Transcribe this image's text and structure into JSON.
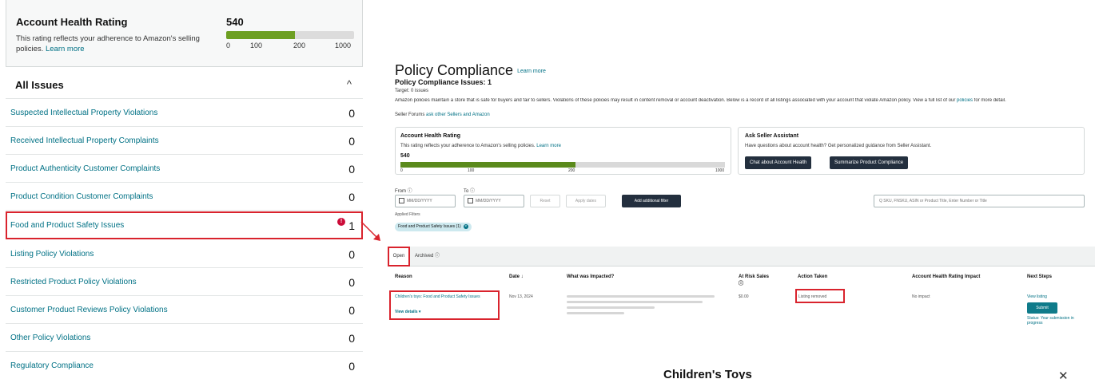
{
  "left_panel": {
    "ahr": {
      "title": "Account Health Rating",
      "description": "This rating reflects your adherence to Amazon's selling policies.",
      "learn_more": "Learn more",
      "score": "540",
      "score_fraction": 0.54,
      "bar_color": "#6d9f22",
      "ticks": [
        "0",
        "100",
        "200",
        "1000"
      ]
    },
    "all_issues": {
      "title": "All Issues",
      "chevron": "^"
    },
    "issues": [
      {
        "label": "Suspected Intellectual Property Violations",
        "count": "0"
      },
      {
        "label": "Received Intellectual Property Complaints",
        "count": "0"
      },
      {
        "label": "Product Authenticity Customer Complaints",
        "count": "0"
      },
      {
        "label": "Product Condition Customer Complaints",
        "count": "0"
      },
      {
        "label": "Food and Product Safety Issues",
        "count": "1",
        "alert": "!"
      },
      {
        "label": "Listing Policy Violations",
        "count": "0"
      },
      {
        "label": "Restricted Product Policy Violations",
        "count": "0"
      },
      {
        "label": "Customer Product Reviews Policy Violations",
        "count": "0"
      },
      {
        "label": "Other Policy Violations",
        "count": "0"
      },
      {
        "label": "Regulatory Compliance",
        "count": "0"
      }
    ],
    "highlight_color": "#d9232d"
  },
  "right_panel": {
    "title": "Policy Compliance",
    "learn_more": "Learn more",
    "subtitle": "Policy Compliance Issues: 1",
    "target": "Target: 0 issues",
    "intro": "Amazon policies maintain a store that is safe for buyers and fair to sellers. Violations of these policies may result in content removal or account deactivation. Below is a record of all listings associated with your account that violate Amazon policy. View a full list of our",
    "intro_link": "policies",
    "intro_end": "for more detail.",
    "seller_forums_pre": "Seller Forums",
    "seller_forums_link": "ask other Sellers and Amazon",
    "ahr_card": {
      "title": "Account Health Rating",
      "desc": "This rating reflects your adherence to Amazon's selling policies.",
      "learn_more": "Learn more",
      "score": "540",
      "score_fraction": 0.54,
      "bar_color": "#5b8a1c",
      "ticks": [
        "0",
        "100",
        "200",
        "1000"
      ]
    },
    "assistant_card": {
      "title": "Ask Seller Assistant",
      "desc": "Have questions about account health? Get personalized guidance from Seller Assistant.",
      "btn1": "Chat about Account Health",
      "btn2": "Summarize Product Compliance"
    },
    "filters": {
      "from_label": "From ⓘ",
      "to_label": "To ⓘ",
      "from_value": "MM/DD/YYYY",
      "to_value": "MM/DD/YYYY",
      "reset": "Reset",
      "apply": "Apply dates",
      "more_filters": "Add additional filter",
      "search_placeholder": "Q  SKU, FNSKU, ASIN or Product Title, Enter Number or Title",
      "applied_label": "Applied Filters",
      "chip": "Food and Product Safety Issues (1)",
      "chip_x": "×"
    },
    "tabs": {
      "open": "Open",
      "archived": "Archived ⓘ"
    },
    "table": {
      "headers": {
        "reason": "Reason",
        "date": "Date ↓",
        "impacted": "What was Impacted?",
        "at_risk": "At Risk Sales ⓘ",
        "action": "Action Taken",
        "ahr_impact": "Account Health Rating Impact",
        "next": "Next Steps"
      },
      "row": {
        "reason": "Children's toys: Food and Product Safety Issues",
        "view_details": "View details ▾",
        "date": "Nov 13, 2024",
        "at_risk": "$0.00",
        "action": "Listing removed",
        "ahr_impact": "No impact",
        "next_link": "View listing",
        "resolve": "Submit",
        "next_note": "Status: Your submission in progress"
      }
    },
    "modal_title": "Children's Toys",
    "modal_close": "✕"
  }
}
